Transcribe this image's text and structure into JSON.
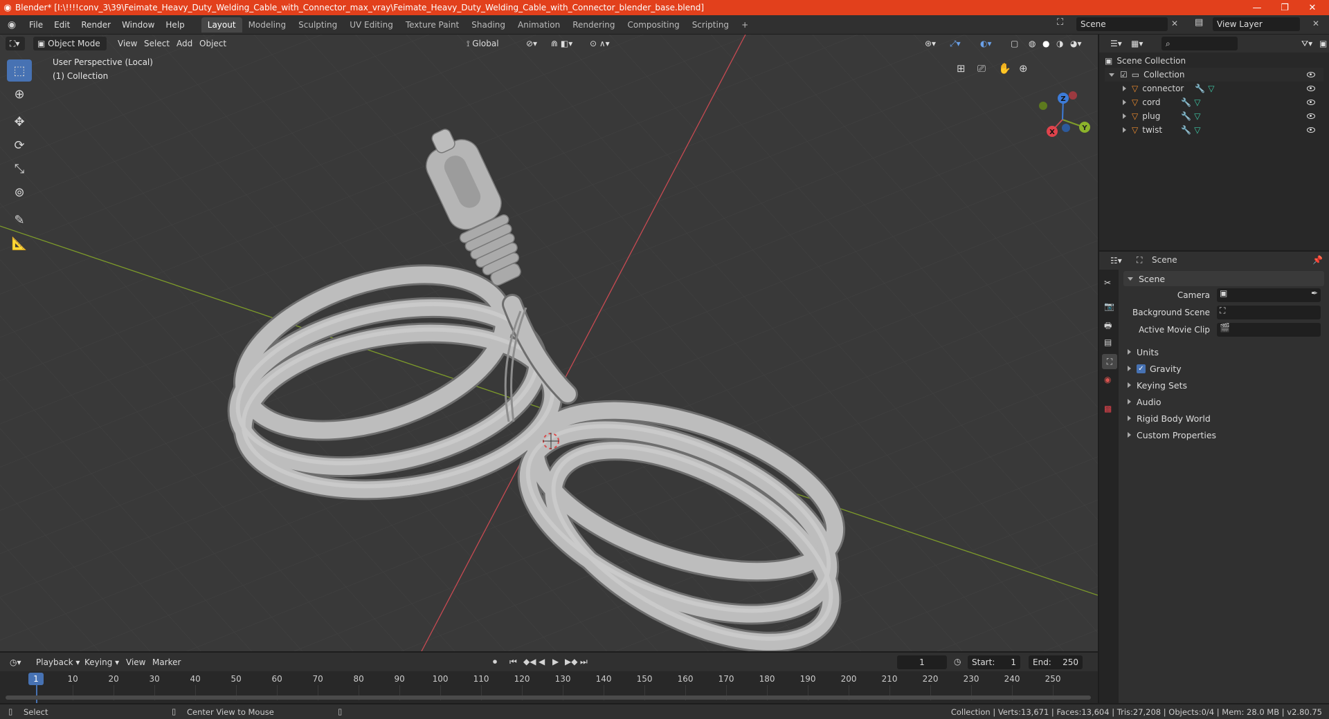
{
  "window": {
    "title": "Blender* [I:\\!!!!conv_3\\39\\Feimate_Heavy_Duty_Welding_Cable_with_Connector_max_vray\\Feimate_Heavy_Duty_Welding_Cable_with_Connector_blender_base.blend]"
  },
  "menu": {
    "items": [
      "File",
      "Edit",
      "Render",
      "Window",
      "Help"
    ],
    "workspaces": [
      "Layout",
      "Modeling",
      "Sculpting",
      "UV Editing",
      "Texture Paint",
      "Shading",
      "Animation",
      "Rendering",
      "Compositing",
      "Scripting"
    ],
    "active_workspace": "Layout",
    "add_tab": "+",
    "scene": "Scene",
    "view_layer": "View Layer"
  },
  "viewport": {
    "mode": "Object Mode",
    "menus": [
      "View",
      "Select",
      "Add",
      "Object"
    ],
    "orientation": "Global",
    "overlay_line1": "User Perspective (Local)",
    "overlay_line2": "(1) Collection",
    "gizmo": {
      "x": "X",
      "y": "Y",
      "z": "Z"
    },
    "colors": {
      "background": "#393939",
      "grid": "#434343",
      "x_axis": "#c84a52",
      "y_axis": "#7e9c2a",
      "cable": "#b8b8b8",
      "active_tool": "#4772b3"
    }
  },
  "outliner": {
    "root": "Scene Collection",
    "collection": "Collection",
    "objects": [
      "connector",
      "cord",
      "plug",
      "twist"
    ]
  },
  "properties": {
    "context": "Scene",
    "panel": "Scene",
    "fields": [
      {
        "label": "Camera"
      },
      {
        "label": "Background Scene"
      },
      {
        "label": "Active Movie Clip"
      }
    ],
    "subpanels": [
      "Units",
      "Gravity",
      "Keying Sets",
      "Audio",
      "Rigid Body World",
      "Custom Properties"
    ],
    "gravity_checked": true
  },
  "timeline": {
    "menus": [
      "Playback",
      "Keying",
      "View",
      "Marker"
    ],
    "current_frame": "1",
    "start_label": "Start:",
    "start": "1",
    "end_label": "End:",
    "end": "250",
    "ticks": [
      "1",
      "10",
      "20",
      "30",
      "40",
      "50",
      "60",
      "70",
      "80",
      "90",
      "100",
      "110",
      "120",
      "130",
      "140",
      "150",
      "160",
      "170",
      "180",
      "190",
      "200",
      "210",
      "220",
      "230",
      "240",
      "250"
    ]
  },
  "status": {
    "left": "Select",
    "middle": "Center View to Mouse",
    "right": "Collection | Verts:13,671 | Faces:13,604 | Tris:27,208 | Objects:0/4 | Mem: 28.0 MB | v2.80.75"
  }
}
